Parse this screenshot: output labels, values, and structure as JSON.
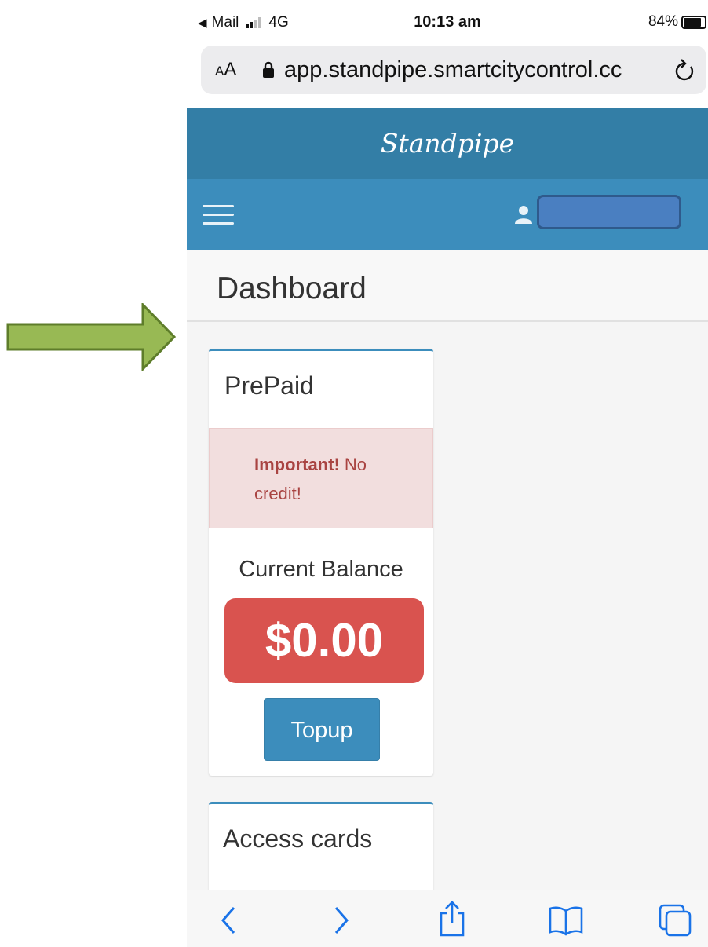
{
  "status_bar": {
    "back_app": "Mail",
    "network": "4G",
    "time": "10:13 am",
    "battery": "84%",
    "battery_level": 0.84
  },
  "browser": {
    "text_size_label": "AA",
    "url": "app.standpipe.smartcitycontrol.cc"
  },
  "app": {
    "title": "Standpipe",
    "accent_color": "#3c8dbc",
    "header_color": "#337ea6"
  },
  "page": {
    "title": "Dashboard"
  },
  "prepaid": {
    "title": "PrePaid",
    "alert_strong": "Important!",
    "alert_text": " No credit!",
    "balance_label": "Current Balance",
    "balance": "$0.00",
    "topup_label": "Topup",
    "balance_color": "#d9534f"
  },
  "access_cards": {
    "title": "Access cards"
  },
  "icons": [
    "arrow-right-icon",
    "lock-icon",
    "reload-icon",
    "hamburger-menu-icon",
    "user-icon",
    "back-icon",
    "forward-icon",
    "share-icon",
    "bookmarks-icon",
    "tabs-icon"
  ]
}
